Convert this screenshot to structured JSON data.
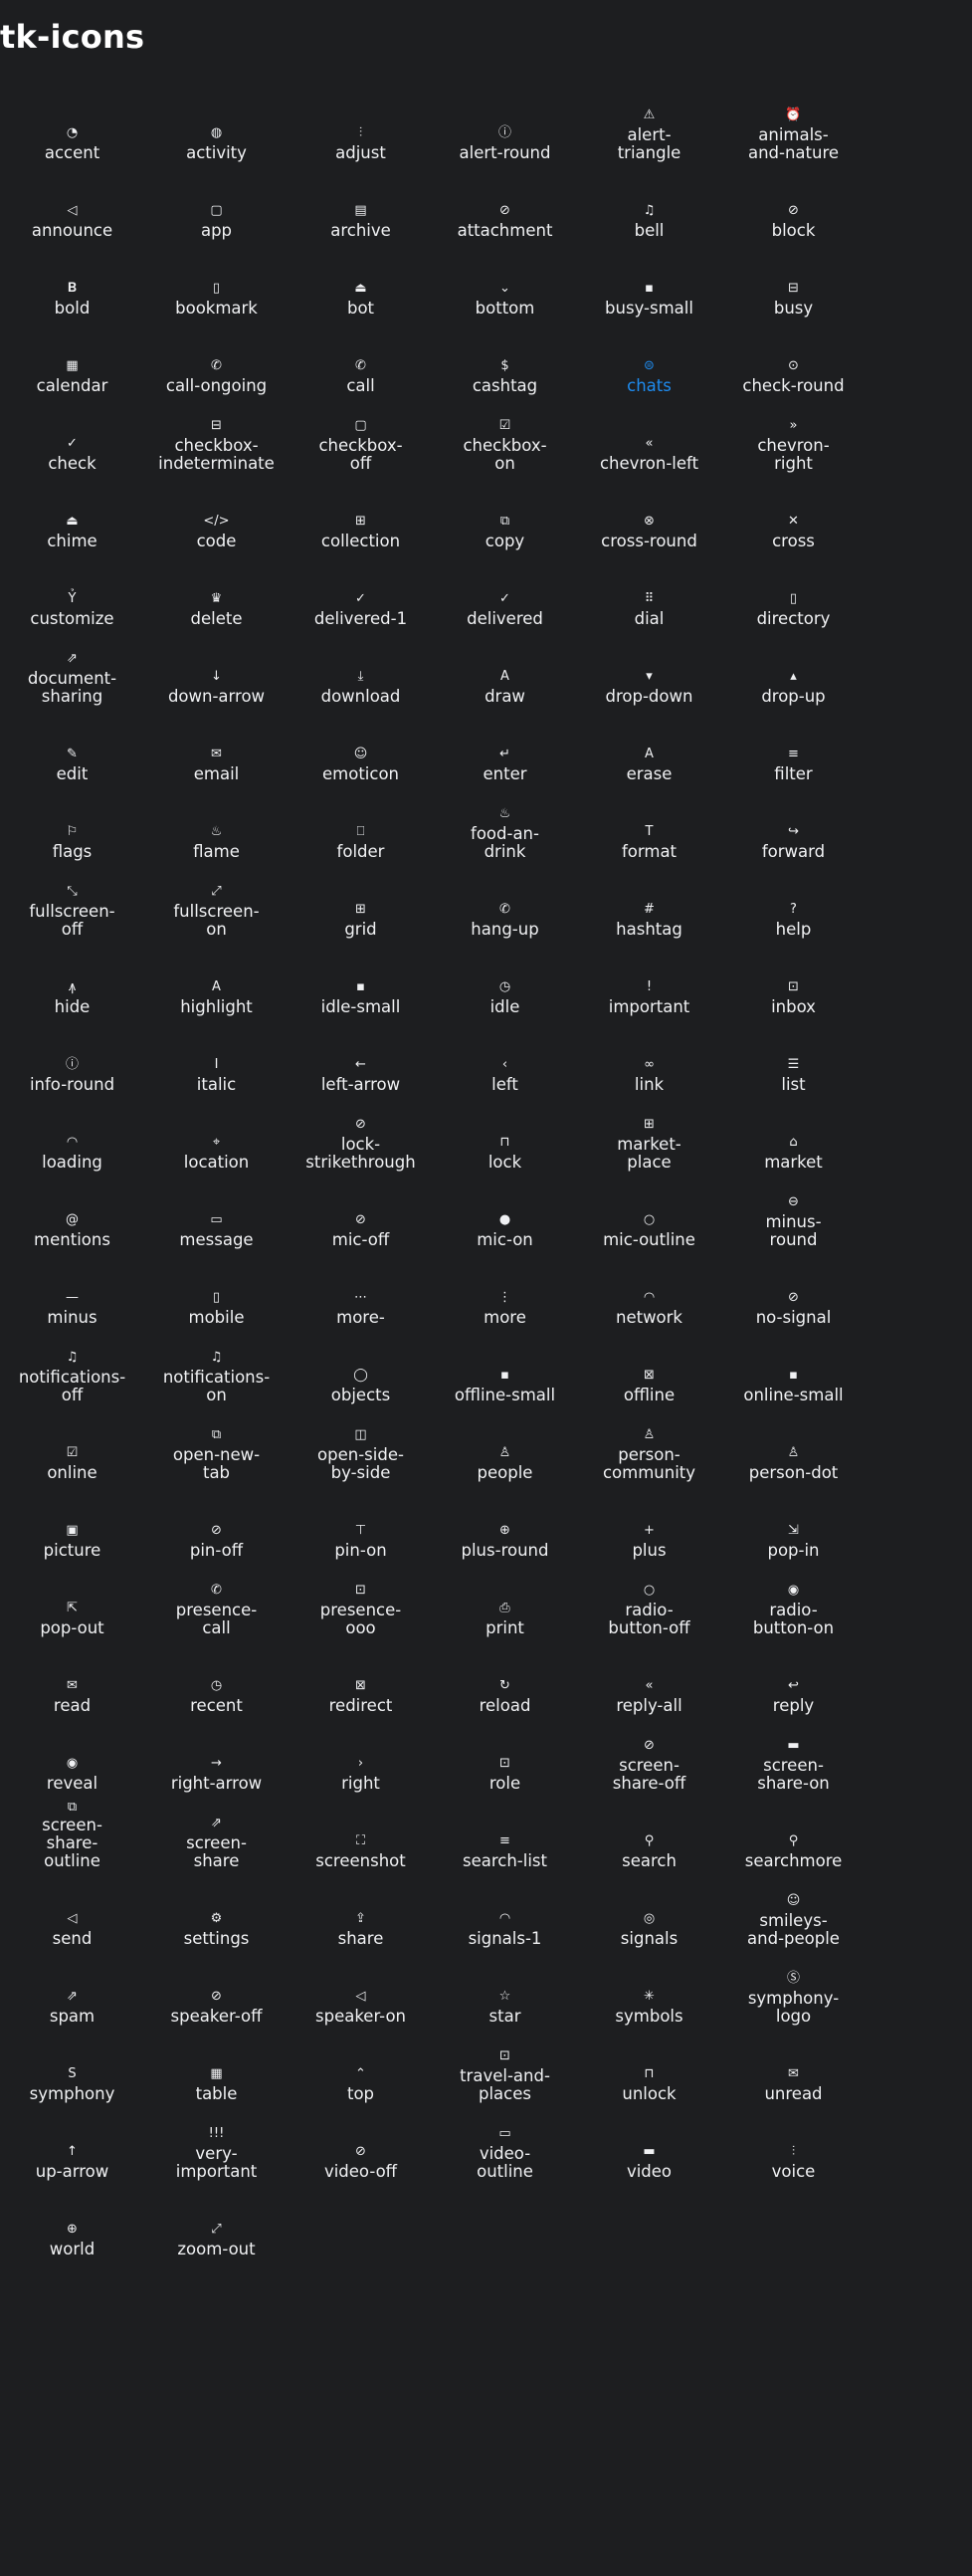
{
  "page": {
    "title": "tk-icons"
  },
  "colors": {
    "background": "#1d1e20",
    "text": "#f0f1f3",
    "active": "#1e8cf0"
  },
  "active_icon": "chats",
  "icons": [
    {
      "name": "accent",
      "label": "accent",
      "glyph": "◔"
    },
    {
      "name": "activity",
      "label": "activity",
      "glyph": "◍"
    },
    {
      "name": "adjust",
      "label": "adjust",
      "glyph": "⫶"
    },
    {
      "name": "alert-round",
      "label": "alert-round",
      "glyph": "ⓘ"
    },
    {
      "name": "alert-triangle",
      "label": "alert-\ntriangle",
      "glyph": "⚠"
    },
    {
      "name": "animals-and-nature",
      "label": "animals-\nand-nature",
      "glyph": "⏰"
    },
    {
      "name": "announce",
      "label": "announce",
      "glyph": "◁"
    },
    {
      "name": "app",
      "label": "app",
      "glyph": "▢"
    },
    {
      "name": "archive",
      "label": "archive",
      "glyph": "▤"
    },
    {
      "name": "attachment",
      "label": "attachment",
      "glyph": "⊘"
    },
    {
      "name": "bell",
      "label": "bell",
      "glyph": "♫"
    },
    {
      "name": "block",
      "label": "block",
      "glyph": "⊘"
    },
    {
      "name": "bold",
      "label": "bold",
      "glyph": "𝐁"
    },
    {
      "name": "bookmark",
      "label": "bookmark",
      "glyph": "▯"
    },
    {
      "name": "bot",
      "label": "bot",
      "glyph": "⏏"
    },
    {
      "name": "bottom",
      "label": "bottom",
      "glyph": "⌄"
    },
    {
      "name": "busy-small",
      "label": "busy-small",
      "glyph": "▪"
    },
    {
      "name": "busy",
      "label": "busy",
      "glyph": "⊟"
    },
    {
      "name": "calendar",
      "label": "calendar",
      "glyph": "▦"
    },
    {
      "name": "call-ongoing",
      "label": "call-ongoing",
      "glyph": "✆"
    },
    {
      "name": "call",
      "label": "call",
      "glyph": "✆"
    },
    {
      "name": "cashtag",
      "label": "cashtag",
      "glyph": "$"
    },
    {
      "name": "chats",
      "label": "chats",
      "glyph": "⊜"
    },
    {
      "name": "check-round",
      "label": "check-round",
      "glyph": "⊙"
    },
    {
      "name": "check",
      "label": "check",
      "glyph": "✓"
    },
    {
      "name": "checkbox-indeterminate",
      "label": "checkbox-\nindeterminate",
      "glyph": "⊟"
    },
    {
      "name": "checkbox-off",
      "label": "checkbox-\noff",
      "glyph": "▢"
    },
    {
      "name": "checkbox-on",
      "label": "checkbox-\non",
      "glyph": "☑"
    },
    {
      "name": "chevron-left",
      "label": "chevron-left",
      "glyph": "«"
    },
    {
      "name": "chevron-right",
      "label": "chevron-\nright",
      "glyph": "»"
    },
    {
      "name": "chime",
      "label": "chime",
      "glyph": "⏏"
    },
    {
      "name": "code",
      "label": "code",
      "glyph": "</>"
    },
    {
      "name": "collection",
      "label": "collection",
      "glyph": "⊞"
    },
    {
      "name": "copy",
      "label": "copy",
      "glyph": "⧉"
    },
    {
      "name": "cross-round",
      "label": "cross-round",
      "glyph": "⊗"
    },
    {
      "name": "cross",
      "label": "cross",
      "glyph": "✕"
    },
    {
      "name": "customize",
      "label": "customize",
      "glyph": "Ỷ"
    },
    {
      "name": "delete",
      "label": "delete",
      "glyph": "♛"
    },
    {
      "name": "delivered-1",
      "label": "delivered-1",
      "glyph": "✓"
    },
    {
      "name": "delivered",
      "label": "delivered",
      "glyph": "✓"
    },
    {
      "name": "dial",
      "label": "dial",
      "glyph": "⠿"
    },
    {
      "name": "directory",
      "label": "directory",
      "glyph": "▯"
    },
    {
      "name": "document-sharing",
      "label": "document-\nsharing",
      "glyph": "⇗"
    },
    {
      "name": "down-arrow",
      "label": "down-arrow",
      "glyph": "↓"
    },
    {
      "name": "download",
      "label": "download",
      "glyph": "⤓"
    },
    {
      "name": "draw",
      "label": "draw",
      "glyph": "A"
    },
    {
      "name": "drop-down",
      "label": "drop-down",
      "glyph": "▾"
    },
    {
      "name": "drop-up",
      "label": "drop-up",
      "glyph": "▴"
    },
    {
      "name": "edit",
      "label": "edit",
      "glyph": "✎"
    },
    {
      "name": "email",
      "label": "email",
      "glyph": "✉"
    },
    {
      "name": "emoticon",
      "label": "emoticon",
      "glyph": "☺"
    },
    {
      "name": "enter",
      "label": "enter",
      "glyph": "↵"
    },
    {
      "name": "erase",
      "label": "erase",
      "glyph": "A"
    },
    {
      "name": "filter",
      "label": "filter",
      "glyph": "≡"
    },
    {
      "name": "flags",
      "label": "flags",
      "glyph": "⚐"
    },
    {
      "name": "flame",
      "label": "flame",
      "glyph": "♨"
    },
    {
      "name": "folder",
      "label": "folder",
      "glyph": "⎕"
    },
    {
      "name": "food-an-drink",
      "label": "food-an-\ndrink",
      "glyph": "♨"
    },
    {
      "name": "format",
      "label": "format",
      "glyph": "T"
    },
    {
      "name": "forward",
      "label": "forward",
      "glyph": "↪"
    },
    {
      "name": "fullscreen-off",
      "label": "fullscreen-\noff",
      "glyph": "⤡"
    },
    {
      "name": "fullscreen-on",
      "label": "fullscreen-\non",
      "glyph": "⤢"
    },
    {
      "name": "grid",
      "label": "grid",
      "glyph": "⊞"
    },
    {
      "name": "hang-up",
      "label": "hang-up",
      "glyph": "✆"
    },
    {
      "name": "hashtag",
      "label": "hashtag",
      "glyph": "#"
    },
    {
      "name": "help",
      "label": "help",
      "glyph": "?"
    },
    {
      "name": "hide",
      "label": "hide",
      "glyph": "ꙟ"
    },
    {
      "name": "highlight",
      "label": "highlight",
      "glyph": "A"
    },
    {
      "name": "idle-small",
      "label": "idle-small",
      "glyph": "▪"
    },
    {
      "name": "idle",
      "label": "idle",
      "glyph": "◷"
    },
    {
      "name": "important",
      "label": "important",
      "glyph": "!"
    },
    {
      "name": "inbox",
      "label": "inbox",
      "glyph": "⊡"
    },
    {
      "name": "info-round",
      "label": "info-round",
      "glyph": "ⓘ"
    },
    {
      "name": "italic",
      "label": "italic",
      "glyph": "I"
    },
    {
      "name": "left-arrow",
      "label": "left-arrow",
      "glyph": "←"
    },
    {
      "name": "left",
      "label": "left",
      "glyph": "‹"
    },
    {
      "name": "link",
      "label": "link",
      "glyph": "∞"
    },
    {
      "name": "list",
      "label": "list",
      "glyph": "☰"
    },
    {
      "name": "loading",
      "label": "loading",
      "glyph": "◠"
    },
    {
      "name": "location",
      "label": "location",
      "glyph": "⌖"
    },
    {
      "name": "lock-strikethrough",
      "label": "lock-\nstrikethrough",
      "glyph": "⊘"
    },
    {
      "name": "lock",
      "label": "lock",
      "glyph": "⊓"
    },
    {
      "name": "market-place",
      "label": "market-\nplace",
      "glyph": "⊞"
    },
    {
      "name": "market",
      "label": "market",
      "glyph": "⌂"
    },
    {
      "name": "mentions",
      "label": "mentions",
      "glyph": "@"
    },
    {
      "name": "message",
      "label": "message",
      "glyph": "▭"
    },
    {
      "name": "mic-off",
      "label": "mic-off",
      "glyph": "⊘"
    },
    {
      "name": "mic-on",
      "label": "mic-on",
      "glyph": "●"
    },
    {
      "name": "mic-outline",
      "label": "mic-outline",
      "glyph": "○"
    },
    {
      "name": "minus-round",
      "label": "minus-\nround",
      "glyph": "⊖"
    },
    {
      "name": "minus",
      "label": "minus",
      "glyph": "—"
    },
    {
      "name": "mobile",
      "label": "mobile",
      "glyph": "▯"
    },
    {
      "name": "more-",
      "label": "more-",
      "glyph": "⋯"
    },
    {
      "name": "more",
      "label": "more",
      "glyph": "⋮"
    },
    {
      "name": "network",
      "label": "network",
      "glyph": "◠"
    },
    {
      "name": "no-signal",
      "label": "no-signal",
      "glyph": "⊘"
    },
    {
      "name": "notifications-off",
      "label": "notifications-\noff",
      "glyph": "♫"
    },
    {
      "name": "notifications-on",
      "label": "notifications-\non",
      "glyph": "♫"
    },
    {
      "name": "objects",
      "label": "objects",
      "glyph": "◯"
    },
    {
      "name": "offline-small",
      "label": "offline-small",
      "glyph": "▪"
    },
    {
      "name": "offline",
      "label": "offline",
      "glyph": "⊠"
    },
    {
      "name": "online-small",
      "label": "online-small",
      "glyph": "▪"
    },
    {
      "name": "online",
      "label": "online",
      "glyph": "☑"
    },
    {
      "name": "open-new-tab",
      "label": "open-new-\ntab",
      "glyph": "⧉"
    },
    {
      "name": "open-side-by-side",
      "label": "open-side-\nby-side",
      "glyph": "◫"
    },
    {
      "name": "people",
      "label": "people",
      "glyph": "♙"
    },
    {
      "name": "person-community",
      "label": "person-\ncommunity",
      "glyph": "♙"
    },
    {
      "name": "person-dot",
      "label": "person-dot",
      "glyph": "♙"
    },
    {
      "name": "picture",
      "label": "picture",
      "glyph": "▣"
    },
    {
      "name": "pin-off",
      "label": "pin-off",
      "glyph": "⊘"
    },
    {
      "name": "pin-on",
      "label": "pin-on",
      "glyph": "⊤"
    },
    {
      "name": "plus-round",
      "label": "plus-round",
      "glyph": "⊕"
    },
    {
      "name": "plus",
      "label": "plus",
      "glyph": "+"
    },
    {
      "name": "pop-in",
      "label": "pop-in",
      "glyph": "⇲"
    },
    {
      "name": "pop-out",
      "label": "pop-out",
      "glyph": "⇱"
    },
    {
      "name": "presence-call",
      "label": "presence-\ncall",
      "glyph": "✆"
    },
    {
      "name": "presence-ooo",
      "label": "presence-\nooo",
      "glyph": "⊡"
    },
    {
      "name": "print",
      "label": "print",
      "glyph": "⎙"
    },
    {
      "name": "radio-button-off",
      "label": "radio-\nbutton-off",
      "glyph": "○"
    },
    {
      "name": "radio-button-on",
      "label": "radio-\nbutton-on",
      "glyph": "◉"
    },
    {
      "name": "read",
      "label": "read",
      "glyph": "✉"
    },
    {
      "name": "recent",
      "label": "recent",
      "glyph": "◷"
    },
    {
      "name": "redirect",
      "label": "redirect",
      "glyph": "⊠"
    },
    {
      "name": "reload",
      "label": "reload",
      "glyph": "↻"
    },
    {
      "name": "reply-all",
      "label": "reply-all",
      "glyph": "«"
    },
    {
      "name": "reply",
      "label": "reply",
      "glyph": "↩"
    },
    {
      "name": "reveal",
      "label": "reveal",
      "glyph": "◉"
    },
    {
      "name": "right-arrow",
      "label": "right-arrow",
      "glyph": "→"
    },
    {
      "name": "right",
      "label": "right",
      "glyph": "›"
    },
    {
      "name": "role",
      "label": "role",
      "glyph": "⊡"
    },
    {
      "name": "screen-share-off",
      "label": "screen-\nshare-off",
      "glyph": "⊘"
    },
    {
      "name": "screen-share-on",
      "label": "screen-\nshare-on",
      "glyph": "▬"
    },
    {
      "name": "screen-share-outline",
      "label": "screen-\nshare-\noutline",
      "glyph": "⧉"
    },
    {
      "name": "screen-share",
      "label": "screen-\nshare",
      "glyph": "⇗"
    },
    {
      "name": "screenshot",
      "label": "screenshot",
      "glyph": "⛶"
    },
    {
      "name": "search-list",
      "label": "search-list",
      "glyph": "≡"
    },
    {
      "name": "search",
      "label": "search",
      "glyph": "⚲"
    },
    {
      "name": "searchmore",
      "label": "searchmore",
      "glyph": "⚲"
    },
    {
      "name": "send",
      "label": "send",
      "glyph": "◁"
    },
    {
      "name": "settings",
      "label": "settings",
      "glyph": "⚙"
    },
    {
      "name": "share",
      "label": "share",
      "glyph": "⇪"
    },
    {
      "name": "signals-1",
      "label": "signals-1",
      "glyph": "◠"
    },
    {
      "name": "signals",
      "label": "signals",
      "glyph": "◎"
    },
    {
      "name": "smileys-and-people",
      "label": "smileys-\nand-people",
      "glyph": "☺"
    },
    {
      "name": "spam",
      "label": "spam",
      "glyph": "⇗"
    },
    {
      "name": "speaker-off",
      "label": "speaker-off",
      "glyph": "⊘"
    },
    {
      "name": "speaker-on",
      "label": "speaker-on",
      "glyph": "◁"
    },
    {
      "name": "star",
      "label": "star",
      "glyph": "☆"
    },
    {
      "name": "symbols",
      "label": "symbols",
      "glyph": "✳"
    },
    {
      "name": "symphony-logo",
      "label": "symphony-\nlogo",
      "glyph": "Ⓢ"
    },
    {
      "name": "symphony",
      "label": "symphony",
      "glyph": "S"
    },
    {
      "name": "table",
      "label": "table",
      "glyph": "▦"
    },
    {
      "name": "top",
      "label": "top",
      "glyph": "⌃"
    },
    {
      "name": "travel-and-places",
      "label": "travel-and-\nplaces",
      "glyph": "⊡"
    },
    {
      "name": "unlock",
      "label": "unlock",
      "glyph": "⊓"
    },
    {
      "name": "unread",
      "label": "unread",
      "glyph": "✉"
    },
    {
      "name": "up-arrow",
      "label": "up-arrow",
      "glyph": "↑"
    },
    {
      "name": "very-important",
      "label": "very-\nimportant",
      "glyph": "!!!"
    },
    {
      "name": "video-off",
      "label": "video-off",
      "glyph": "⊘"
    },
    {
      "name": "video-outline",
      "label": "video-\noutline",
      "glyph": "▭"
    },
    {
      "name": "video",
      "label": "video",
      "glyph": "▬"
    },
    {
      "name": "voice",
      "label": "voice",
      "glyph": "⫶"
    },
    {
      "name": "world",
      "label": "world",
      "glyph": "⊕"
    },
    {
      "name": "zoom-out",
      "label": "zoom-out",
      "glyph": "⤢"
    }
  ]
}
